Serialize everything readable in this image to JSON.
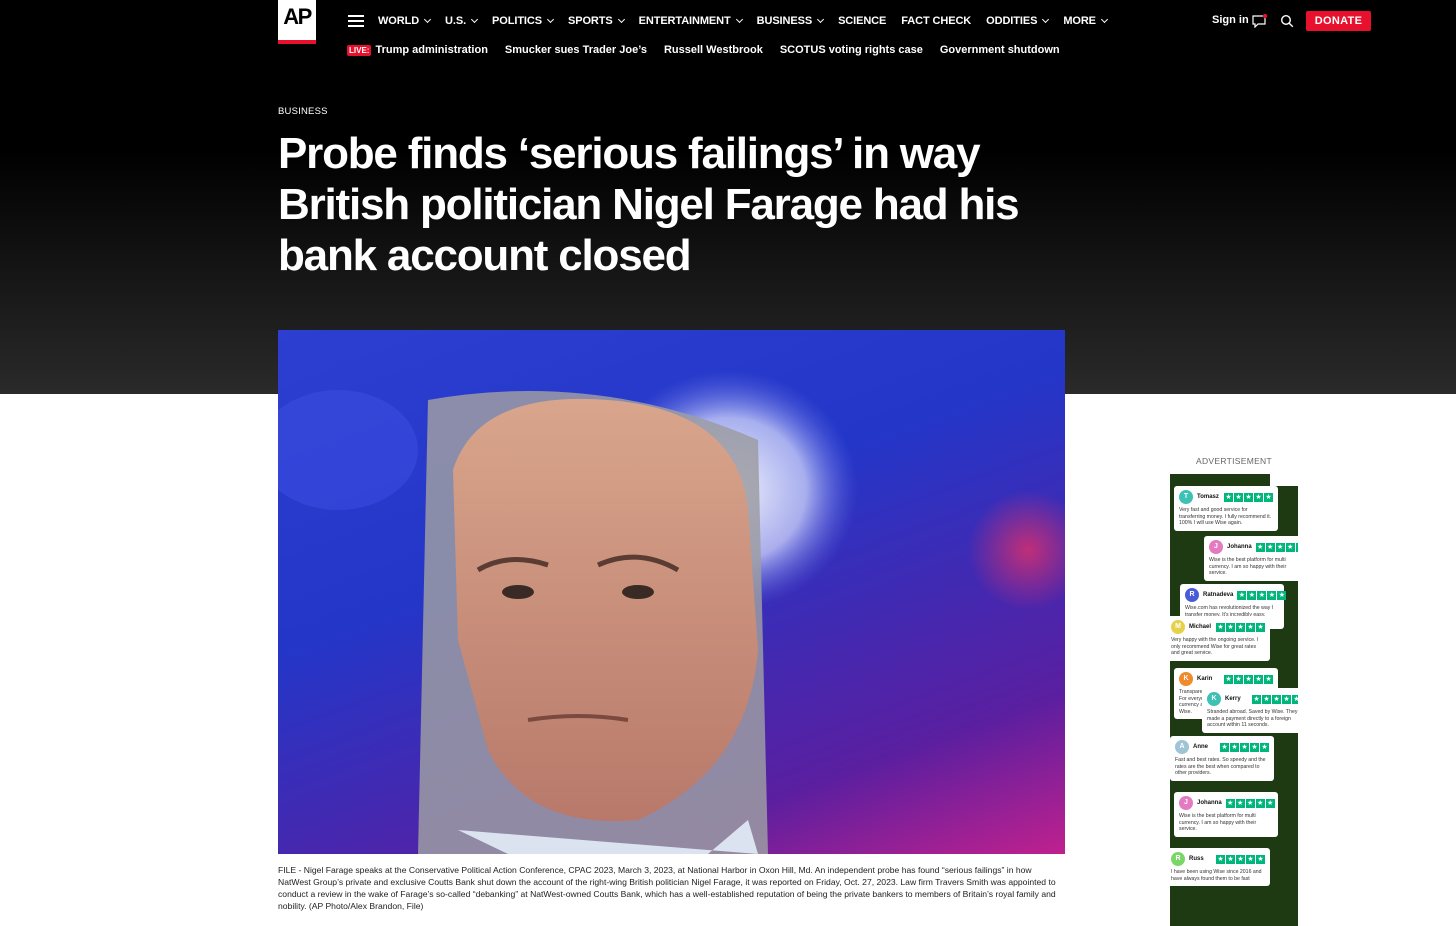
{
  "logo": {
    "text": "AP"
  },
  "nav": {
    "items": [
      {
        "label": "WORLD",
        "has_dropdown": true
      },
      {
        "label": "U.S.",
        "has_dropdown": true
      },
      {
        "label": "POLITICS",
        "has_dropdown": true
      },
      {
        "label": "SPORTS",
        "has_dropdown": true
      },
      {
        "label": "ENTERTAINMENT",
        "has_dropdown": true
      },
      {
        "label": "BUSINESS",
        "has_dropdown": true
      },
      {
        "label": "SCIENCE",
        "has_dropdown": false
      },
      {
        "label": "FACT CHECK",
        "has_dropdown": false
      },
      {
        "label": "ODDITIES",
        "has_dropdown": true
      },
      {
        "label": "MORE",
        "has_dropdown": true
      }
    ],
    "signin": "Sign in",
    "donate": "DONATE"
  },
  "trending": {
    "live_badge": "LIVE:",
    "items": [
      "Trump administration",
      "Smucker sues Trader Joe’s",
      "Russell Westbrook",
      "SCOTUS voting rights case",
      "Government shutdown"
    ]
  },
  "article": {
    "section": "BUSINESS",
    "headline": "Probe finds ‘serious failings’ in way British politician Nigel Farage had his bank account closed",
    "caption": "FILE - Nigel Farage speaks at the Conservative Political Action Conference, CPAC 2023, March 3, 2023, at National Harbor in Oxon Hill, Md. An independent probe has found “serious failings” in how NatWest Group’s private and exclusive Coutts Bank shut down the account of the right-wing British politician Nigel Farage, it was reported on Friday, Oct. 27, 2023. Law firm Travers Smith was appointed to conduct a review in the wake of Farage’s so-called “debanking” at NatWest-owned Coutts Bank, which has a well-established reputation of being the private bankers to members of Britain’s royal family and nobility. (AP Photo/Alex Brandon, File)"
  },
  "ad": {
    "label": "ADVERTISEMENT",
    "reviews": [
      {
        "initial": "T",
        "name": "Tomasz",
        "color": "#3ec1b5",
        "text": "Very fast and good service for transferring money. I fully recommend it. 100% I will use Wise again."
      },
      {
        "initial": "J",
        "name": "Johanna",
        "color": "#e47ac2",
        "text": "Wise is the best platform for multi currency. I am so happy with their service."
      },
      {
        "initial": "R",
        "name": "Ratnadeva",
        "color": "#4a5bd6",
        "text": "Wise.com has revolutionized the way I transfer money. It's incredibly easy, effective"
      },
      {
        "initial": "M",
        "name": "Michael",
        "color": "#e6d24a",
        "text": "Very happy with the ongoing service. I only recommend Wise for great rates and great service."
      },
      {
        "initial": "K",
        "name": "Karin",
        "color": "#f08a2a",
        "text": "Transparent, fair, fast, uncomplicated. For everyone looking for a multi-currency account I fully recommend Wise."
      },
      {
        "initial": "K",
        "name": "Kerry",
        "color": "#3ec1b5",
        "text": "Stranded abroad. Saved by Wise. They made a payment directly to a foreign account within 11 seconds."
      },
      {
        "initial": "A",
        "name": "Anne",
        "color": "#9fc4d6",
        "text": "Fast and best rates. So speedy and the rates are the best when compared to other providers."
      },
      {
        "initial": "J",
        "name": "Johanna",
        "color": "#e47ac2",
        "text": "Wise is the best platform for multi currency. I am so happy with their service."
      },
      {
        "initial": "R",
        "name": "Russ",
        "color": "#7bd66a",
        "text": "I have been using Wise since 2016 and have always found them to be fast"
      }
    ]
  }
}
